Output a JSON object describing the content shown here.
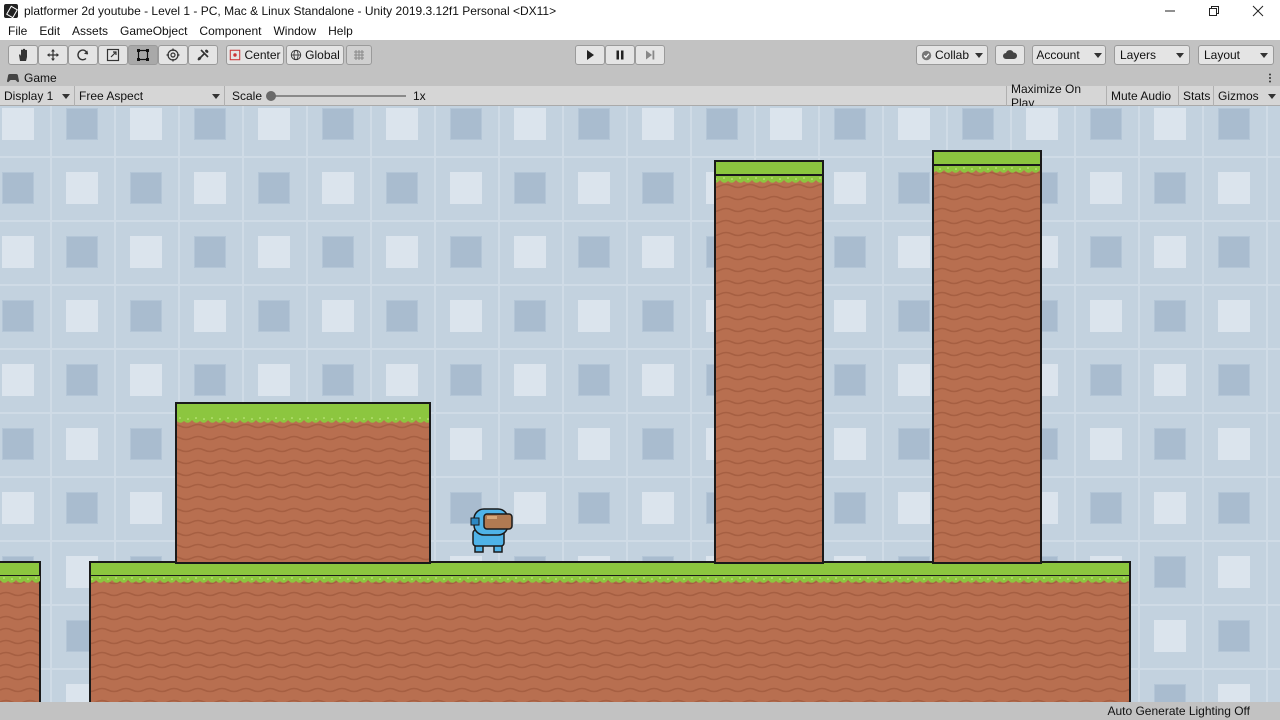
{
  "window": {
    "title": "platformer 2d youtube - Level 1 - PC, Mac & Linux Standalone - Unity 2019.3.12f1 Personal <DX11>",
    "controls": [
      "minimize",
      "restore",
      "close"
    ]
  },
  "menu": [
    "File",
    "Edit",
    "Assets",
    "GameObject",
    "Component",
    "Window",
    "Help"
  ],
  "toolbar": {
    "tools": [
      "hand-tool",
      "move-tool",
      "rotate-tool",
      "scale-tool",
      "rect-tool",
      "transform-tool",
      "custom-tool"
    ],
    "active_tool": "rect-tool",
    "pivot_label": "Center",
    "space_label": "Global",
    "collab_label": "Collab",
    "account_label": "Account",
    "layers_label": "Layers",
    "layout_label": "Layout"
  },
  "game_tab": {
    "label": "Game"
  },
  "game_toolbar": {
    "display": "Display 1",
    "aspect": "Free Aspect",
    "scale_label": "Scale",
    "scale_value": "1x",
    "maximize": "Maximize On Play",
    "mute": "Mute Audio",
    "stats": "Stats",
    "gizmos": "Gizmos"
  },
  "status_bar": {
    "text": "Auto Generate Lighting Off"
  },
  "colors": {
    "bg_light": "#bcccda",
    "bg_tile": "#d6e0ea",
    "bg_tile_dark": "#a9bccf",
    "grass": "#8cc63f",
    "grass_dark": "#5b9a1e",
    "dirt": "#b86f50",
    "dirt_line": "#a35d40",
    "outline": "#1a1a1a",
    "player": "#4fb3e8"
  }
}
